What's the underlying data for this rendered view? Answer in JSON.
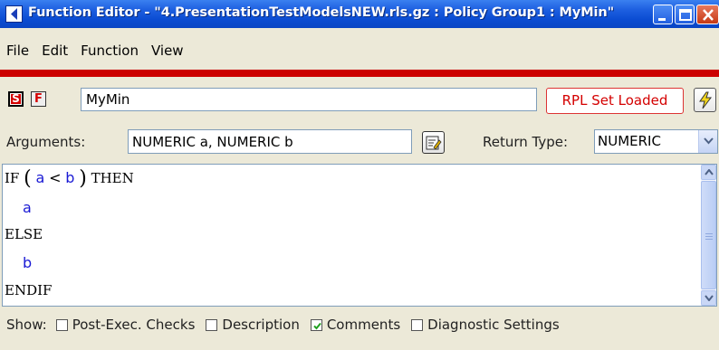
{
  "window": {
    "title": "Function Editor - \"4.PresentationTestModelsNEW.rls.gz : Policy Group1 : MyMin\""
  },
  "menu": [
    "File",
    "Edit",
    "Function",
    "View"
  ],
  "toolbar": {
    "s_badge": "S",
    "f_badge": "F",
    "function_name": "MyMin",
    "rpl_button": "RPL Set Loaded"
  },
  "arguments": {
    "label": "Arguments:",
    "value": "NUMERIC a, NUMERIC b"
  },
  "return_type": {
    "label": "Return Type:",
    "value": "NUMERIC"
  },
  "code": {
    "if_kw": "IF",
    "open_paren": "(",
    "var_a": "a",
    "lt_op": "<",
    "var_b": "b",
    "close_paren": ")",
    "then_kw": "THEN",
    "then_expr": "a",
    "else_kw": "ELSE",
    "else_expr": "b",
    "endif_kw": "ENDIF"
  },
  "show": {
    "label": "Show:",
    "options": [
      {
        "label": "Post-Exec. Checks",
        "checked": false
      },
      {
        "label": "Description",
        "checked": false
      },
      {
        "label": "Comments",
        "checked": true
      },
      {
        "label": "Diagnostic Settings",
        "checked": false
      }
    ]
  },
  "colors": {
    "title_bar": "#0b4cd2",
    "accent_red": "#cc0000",
    "code_variable": "#1a1ad4"
  }
}
